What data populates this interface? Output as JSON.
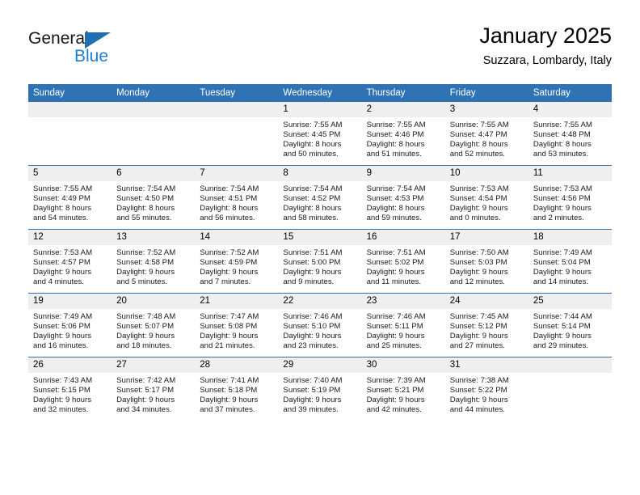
{
  "logo": {
    "word_one": "General",
    "word_two": "Blue",
    "triangle_icon": "blue-triangle-icon",
    "accent_dark": "#1f6fb2",
    "accent_light": "#1a7fd4"
  },
  "header": {
    "title": "January 2025",
    "subtitle": "Suzzara, Lombardy, Italy"
  },
  "theme": {
    "header_blue": "#3073b4",
    "rule_blue": "#2f72b3",
    "daynum_gray": "#efefef"
  },
  "calendar": {
    "weekdays": [
      "Sunday",
      "Monday",
      "Tuesday",
      "Wednesday",
      "Thursday",
      "Friday",
      "Saturday"
    ],
    "weeks": [
      [
        {
          "day": "",
          "sunrise": "",
          "sunset": "",
          "daylight_a": "",
          "daylight_b": ""
        },
        {
          "day": "",
          "sunrise": "",
          "sunset": "",
          "daylight_a": "",
          "daylight_b": ""
        },
        {
          "day": "",
          "sunrise": "",
          "sunset": "",
          "daylight_a": "",
          "daylight_b": ""
        },
        {
          "day": "1",
          "sunrise": "Sunrise: 7:55 AM",
          "sunset": "Sunset: 4:45 PM",
          "daylight_a": "Daylight: 8 hours",
          "daylight_b": "and 50 minutes."
        },
        {
          "day": "2",
          "sunrise": "Sunrise: 7:55 AM",
          "sunset": "Sunset: 4:46 PM",
          "daylight_a": "Daylight: 8 hours",
          "daylight_b": "and 51 minutes."
        },
        {
          "day": "3",
          "sunrise": "Sunrise: 7:55 AM",
          "sunset": "Sunset: 4:47 PM",
          "daylight_a": "Daylight: 8 hours",
          "daylight_b": "and 52 minutes."
        },
        {
          "day": "4",
          "sunrise": "Sunrise: 7:55 AM",
          "sunset": "Sunset: 4:48 PM",
          "daylight_a": "Daylight: 8 hours",
          "daylight_b": "and 53 minutes."
        }
      ],
      [
        {
          "day": "5",
          "sunrise": "Sunrise: 7:55 AM",
          "sunset": "Sunset: 4:49 PM",
          "daylight_a": "Daylight: 8 hours",
          "daylight_b": "and 54 minutes."
        },
        {
          "day": "6",
          "sunrise": "Sunrise: 7:54 AM",
          "sunset": "Sunset: 4:50 PM",
          "daylight_a": "Daylight: 8 hours",
          "daylight_b": "and 55 minutes."
        },
        {
          "day": "7",
          "sunrise": "Sunrise: 7:54 AM",
          "sunset": "Sunset: 4:51 PM",
          "daylight_a": "Daylight: 8 hours",
          "daylight_b": "and 56 minutes."
        },
        {
          "day": "8",
          "sunrise": "Sunrise: 7:54 AM",
          "sunset": "Sunset: 4:52 PM",
          "daylight_a": "Daylight: 8 hours",
          "daylight_b": "and 58 minutes."
        },
        {
          "day": "9",
          "sunrise": "Sunrise: 7:54 AM",
          "sunset": "Sunset: 4:53 PM",
          "daylight_a": "Daylight: 8 hours",
          "daylight_b": "and 59 minutes."
        },
        {
          "day": "10",
          "sunrise": "Sunrise: 7:53 AM",
          "sunset": "Sunset: 4:54 PM",
          "daylight_a": "Daylight: 9 hours",
          "daylight_b": "and 0 minutes."
        },
        {
          "day": "11",
          "sunrise": "Sunrise: 7:53 AM",
          "sunset": "Sunset: 4:56 PM",
          "daylight_a": "Daylight: 9 hours",
          "daylight_b": "and 2 minutes."
        }
      ],
      [
        {
          "day": "12",
          "sunrise": "Sunrise: 7:53 AM",
          "sunset": "Sunset: 4:57 PM",
          "daylight_a": "Daylight: 9 hours",
          "daylight_b": "and 4 minutes."
        },
        {
          "day": "13",
          "sunrise": "Sunrise: 7:52 AM",
          "sunset": "Sunset: 4:58 PM",
          "daylight_a": "Daylight: 9 hours",
          "daylight_b": "and 5 minutes."
        },
        {
          "day": "14",
          "sunrise": "Sunrise: 7:52 AM",
          "sunset": "Sunset: 4:59 PM",
          "daylight_a": "Daylight: 9 hours",
          "daylight_b": "and 7 minutes."
        },
        {
          "day": "15",
          "sunrise": "Sunrise: 7:51 AM",
          "sunset": "Sunset: 5:00 PM",
          "daylight_a": "Daylight: 9 hours",
          "daylight_b": "and 9 minutes."
        },
        {
          "day": "16",
          "sunrise": "Sunrise: 7:51 AM",
          "sunset": "Sunset: 5:02 PM",
          "daylight_a": "Daylight: 9 hours",
          "daylight_b": "and 11 minutes."
        },
        {
          "day": "17",
          "sunrise": "Sunrise: 7:50 AM",
          "sunset": "Sunset: 5:03 PM",
          "daylight_a": "Daylight: 9 hours",
          "daylight_b": "and 12 minutes."
        },
        {
          "day": "18",
          "sunrise": "Sunrise: 7:49 AM",
          "sunset": "Sunset: 5:04 PM",
          "daylight_a": "Daylight: 9 hours",
          "daylight_b": "and 14 minutes."
        }
      ],
      [
        {
          "day": "19",
          "sunrise": "Sunrise: 7:49 AM",
          "sunset": "Sunset: 5:06 PM",
          "daylight_a": "Daylight: 9 hours",
          "daylight_b": "and 16 minutes."
        },
        {
          "day": "20",
          "sunrise": "Sunrise: 7:48 AM",
          "sunset": "Sunset: 5:07 PM",
          "daylight_a": "Daylight: 9 hours",
          "daylight_b": "and 18 minutes."
        },
        {
          "day": "21",
          "sunrise": "Sunrise: 7:47 AM",
          "sunset": "Sunset: 5:08 PM",
          "daylight_a": "Daylight: 9 hours",
          "daylight_b": "and 21 minutes."
        },
        {
          "day": "22",
          "sunrise": "Sunrise: 7:46 AM",
          "sunset": "Sunset: 5:10 PM",
          "daylight_a": "Daylight: 9 hours",
          "daylight_b": "and 23 minutes."
        },
        {
          "day": "23",
          "sunrise": "Sunrise: 7:46 AM",
          "sunset": "Sunset: 5:11 PM",
          "daylight_a": "Daylight: 9 hours",
          "daylight_b": "and 25 minutes."
        },
        {
          "day": "24",
          "sunrise": "Sunrise: 7:45 AM",
          "sunset": "Sunset: 5:12 PM",
          "daylight_a": "Daylight: 9 hours",
          "daylight_b": "and 27 minutes."
        },
        {
          "day": "25",
          "sunrise": "Sunrise: 7:44 AM",
          "sunset": "Sunset: 5:14 PM",
          "daylight_a": "Daylight: 9 hours",
          "daylight_b": "and 29 minutes."
        }
      ],
      [
        {
          "day": "26",
          "sunrise": "Sunrise: 7:43 AM",
          "sunset": "Sunset: 5:15 PM",
          "daylight_a": "Daylight: 9 hours",
          "daylight_b": "and 32 minutes."
        },
        {
          "day": "27",
          "sunrise": "Sunrise: 7:42 AM",
          "sunset": "Sunset: 5:17 PM",
          "daylight_a": "Daylight: 9 hours",
          "daylight_b": "and 34 minutes."
        },
        {
          "day": "28",
          "sunrise": "Sunrise: 7:41 AM",
          "sunset": "Sunset: 5:18 PM",
          "daylight_a": "Daylight: 9 hours",
          "daylight_b": "and 37 minutes."
        },
        {
          "day": "29",
          "sunrise": "Sunrise: 7:40 AM",
          "sunset": "Sunset: 5:19 PM",
          "daylight_a": "Daylight: 9 hours",
          "daylight_b": "and 39 minutes."
        },
        {
          "day": "30",
          "sunrise": "Sunrise: 7:39 AM",
          "sunset": "Sunset: 5:21 PM",
          "daylight_a": "Daylight: 9 hours",
          "daylight_b": "and 42 minutes."
        },
        {
          "day": "31",
          "sunrise": "Sunrise: 7:38 AM",
          "sunset": "Sunset: 5:22 PM",
          "daylight_a": "Daylight: 9 hours",
          "daylight_b": "and 44 minutes."
        },
        {
          "day": "",
          "sunrise": "",
          "sunset": "",
          "daylight_a": "",
          "daylight_b": ""
        }
      ]
    ]
  }
}
